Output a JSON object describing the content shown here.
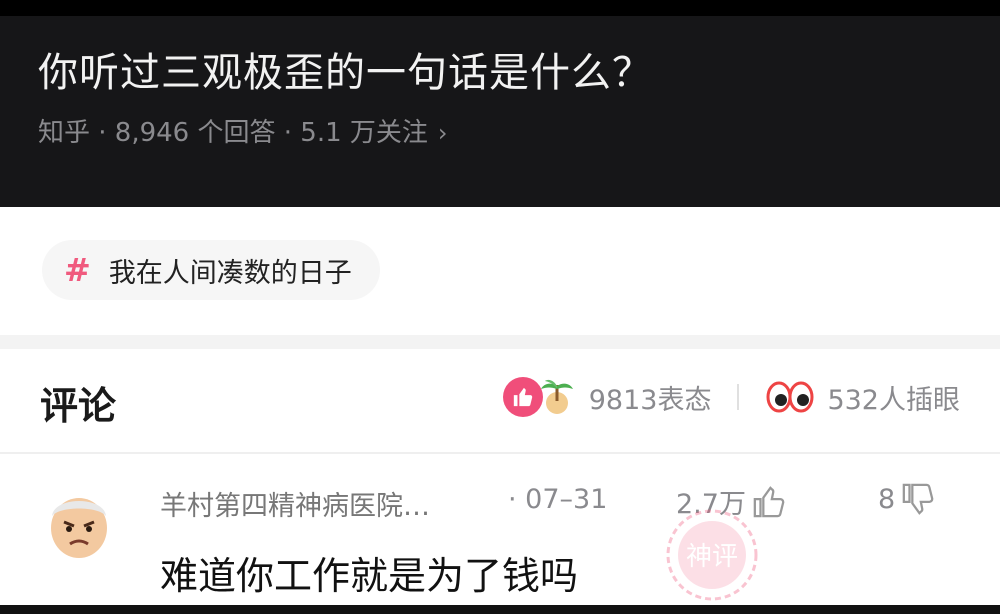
{
  "question": {
    "title": "你听过三观极歪的一句话是什么？",
    "meta": "知乎 · 8,946 个回答 · 5.1 万关注",
    "chevron": "›"
  },
  "topic_tag": {
    "symbol": "#",
    "label": "我在人间凑数的日子",
    "color": "#f05a7e"
  },
  "comments": {
    "title": "评论",
    "reaction_count": "9813表态",
    "watch_count": "532人插眼",
    "items": [
      {
        "author": "羊村第四精神病医院…",
        "date": "· 07–31",
        "likes": "2.7万",
        "dislikes": "8",
        "text": "难道你工作就是为了钱吗",
        "stamp_text": "神评"
      }
    ]
  },
  "icons": {
    "like": "thumbs-up-icon",
    "dislike": "thumbs-down-icon",
    "eyes": "eyes-icon",
    "palm": "palm-tree-icon"
  }
}
